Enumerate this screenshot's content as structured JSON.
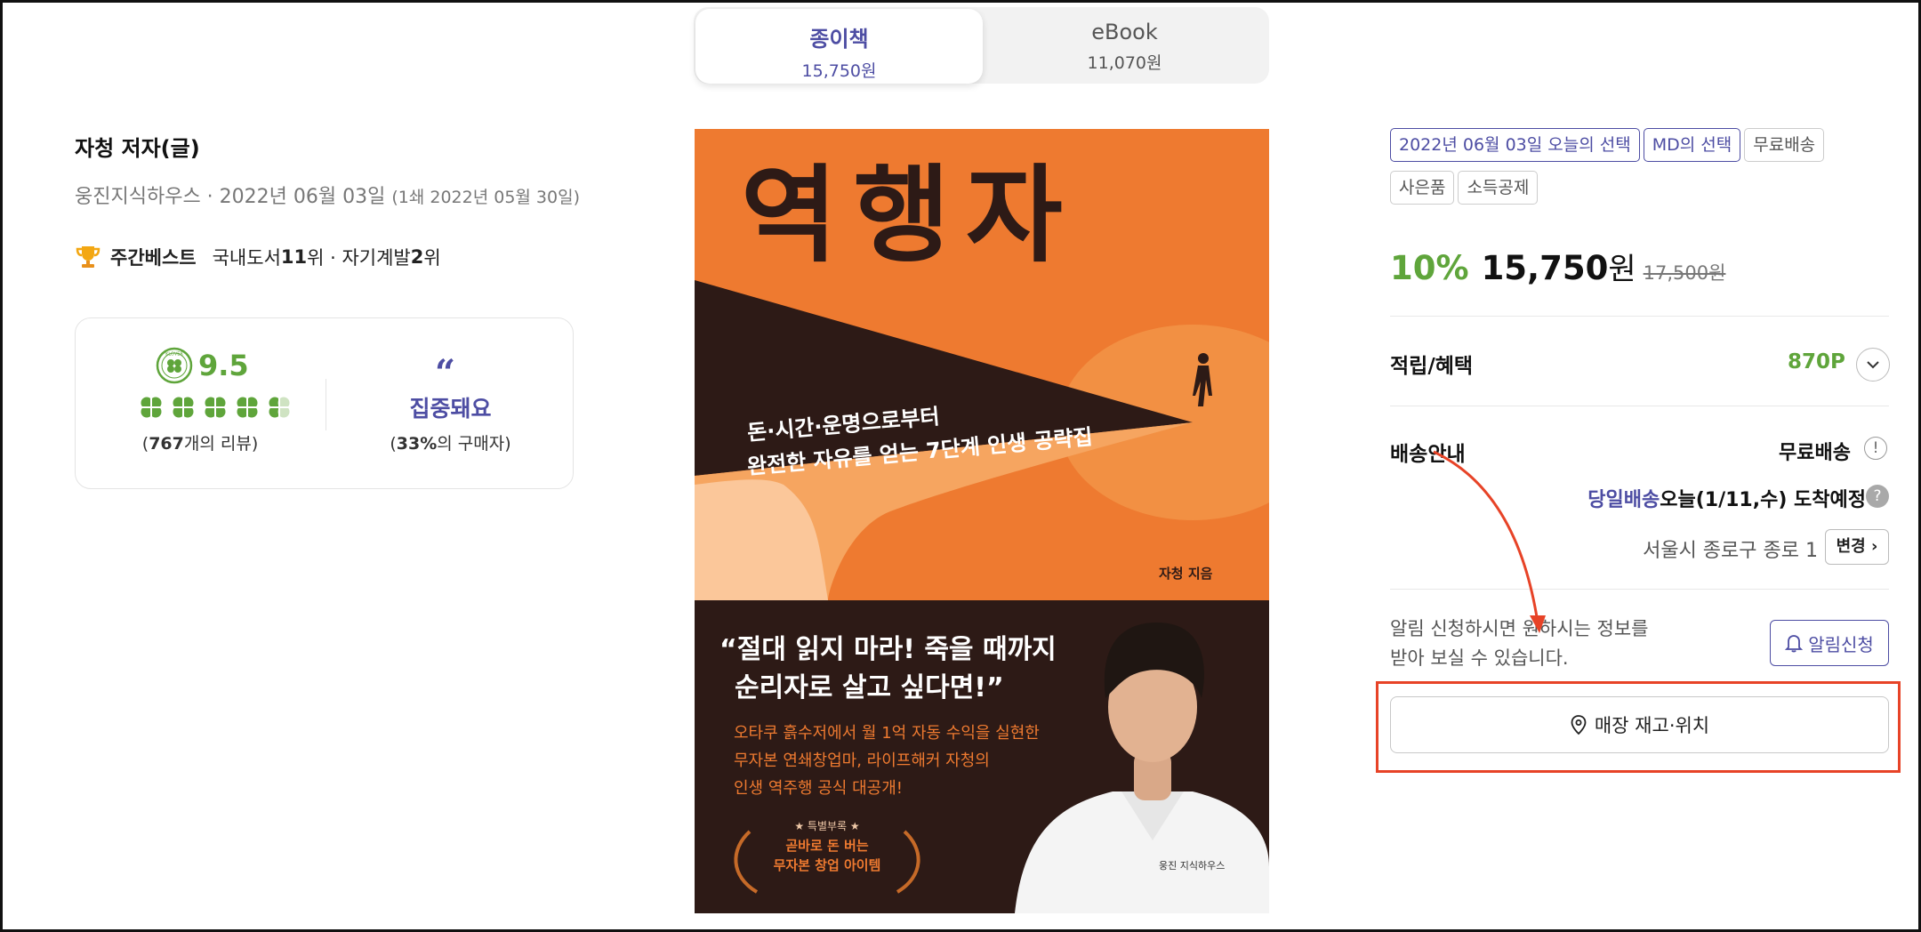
{
  "format_tabs": [
    {
      "name": "종이책",
      "price": "15,750원",
      "active": true
    },
    {
      "name": "eBook",
      "price": "11,070원",
      "active": false
    }
  ],
  "book": {
    "author": "자청 저자(글)",
    "publisher_date": "웅진지식하우스 · 2022년 06월 03일",
    "first_print": "(1쇄 2022년 05월 30일)",
    "bestseller": {
      "label": "주간베스트",
      "domestic_prefix": "국내도서 ",
      "domestic_rank": "11",
      "domestic_suffix": "위 · 자기계발 ",
      "category_rank": "2",
      "category_suffix": "위"
    },
    "rating": {
      "score": "9.5",
      "badge_text": "KLOVER",
      "review_prefix": "(",
      "review_count": "767",
      "review_suffix": "개의 리뷰)"
    },
    "emotion": {
      "label": "집중돼요",
      "pct_prefix": "(",
      "pct": "33%",
      "pct_suffix": "의 구매자)"
    }
  },
  "cover": {
    "title": "역행자",
    "subtitle_line1": "돈·시간·운명으로부터",
    "subtitle_line2": "완전한 자유를 얻는 7단계 인생 공략집",
    "author_tag": "자청 지음",
    "quote_line1": "“절대 읽지 마라! 죽을 때까지",
    "quote_line2": "순리자로 살고 싶다면!”",
    "desc_line1": "오타쿠 흙수저에서 월 1억 자동 수익을 실현한",
    "desc_line2": "무자본 연쇄창업마, 라이프해커 자청의",
    "desc_line3": "인생 역주행 공식 대공개!",
    "bonus_line1": "★ 특별부록 ★",
    "bonus_line2": "곧바로 돈 버는",
    "bonus_line3": "무자본 창업 아이템",
    "publisher_logo": "웅진 지식하우스",
    "bg_color": "#ee7a30",
    "dark_color": "#2d1a16"
  },
  "badges": [
    {
      "label": "2022년 06월 03일 오늘의 선택",
      "primary": true
    },
    {
      "label": "MD의 선택",
      "primary": true
    },
    {
      "label": "무료배송",
      "primary": false
    },
    {
      "label": "사은품",
      "primary": false
    },
    {
      "label": "소득공제",
      "primary": false
    }
  ],
  "price": {
    "discount": "10%",
    "sale": "15,750",
    "unit": "원",
    "original": "17,500원"
  },
  "benefits": {
    "label": "적립/혜택",
    "points": "870P"
  },
  "shipping": {
    "label": "배송안내",
    "free": "무료배송",
    "sameday_highlight": "당일배송",
    "sameday_rest": "오늘(1/11,수) 도착예정",
    "address": "서울시 종로구 종로 1",
    "change": "변경"
  },
  "notify": {
    "line1": "알림 신청하시면 원하시는 정보를",
    "line2": "받아 보실 수 있습니다.",
    "button": "알림신청"
  },
  "store_button": "매장 재고·위치",
  "colors": {
    "accent_blue": "#4d4da3",
    "accent_green": "#5fa53b",
    "annotation_red": "#e74327"
  }
}
